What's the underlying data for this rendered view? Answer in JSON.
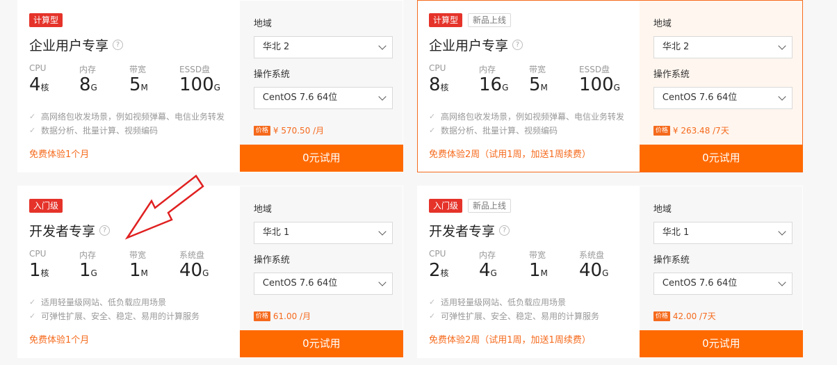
{
  "cards": [
    {
      "tags": [
        "计算型"
      ],
      "title": "企业用户专享",
      "specs": [
        {
          "label": "CPU",
          "value": "4",
          "unit": "核"
        },
        {
          "label": "内存",
          "value": "8",
          "unit": "G"
        },
        {
          "label": "带宽",
          "value": "5",
          "unit": "M"
        },
        {
          "label": "ESSD盘",
          "value": "100",
          "unit": "G"
        }
      ],
      "features": [
        "高网络包收发场景，例如视频弹幕、电信业务转发",
        "数据分析、批量计算、视频编码"
      ],
      "trial_note": "免费体验1个月",
      "region_label": "地域",
      "region": "华北 2",
      "os_label": "操作系统",
      "os": "CentOS 7.6 64位",
      "price_badge": "价格",
      "price": "¥ 570.50 /月",
      "button": "0元试用"
    },
    {
      "tags": [
        "计算型",
        "新品上线"
      ],
      "title": "企业用户专享",
      "specs": [
        {
          "label": "CPU",
          "value": "8",
          "unit": "核"
        },
        {
          "label": "内存",
          "value": "16",
          "unit": "G"
        },
        {
          "label": "带宽",
          "value": "5",
          "unit": "M"
        },
        {
          "label": "ESSD盘",
          "value": "100",
          "unit": "G"
        }
      ],
      "features": [
        "高网络包收发场景，例如视频弹幕、电信业务转发",
        "数据分析、批量计算、视频编码"
      ],
      "trial_note": "免费体验2周（试用1周，加送1周续费）",
      "region_label": "地域",
      "region": "华北 2",
      "os_label": "操作系统",
      "os": "CentOS 7.6 64位",
      "price_badge": "价格",
      "price": "¥ 263.48 /7天",
      "button": "0元试用"
    },
    {
      "tags": [
        "入门级"
      ],
      "title": "开发者专享",
      "specs": [
        {
          "label": "CPU",
          "value": "1",
          "unit": "核"
        },
        {
          "label": "内存",
          "value": "1",
          "unit": "G"
        },
        {
          "label": "带宽",
          "value": "1",
          "unit": "M"
        },
        {
          "label": "系统盘",
          "value": "40",
          "unit": "G"
        }
      ],
      "features": [
        "适用轻量级网站、低负载应用场景",
        "可弹性扩展、安全、稳定、易用的计算服务"
      ],
      "trial_note": "免费体验1个月",
      "region_label": "地域",
      "region": "华北 1",
      "os_label": "操作系统",
      "os": "CentOS 7.6 64位",
      "price_badge": "价格",
      "price": "61.00 /月",
      "button": "0元试用"
    },
    {
      "tags": [
        "入门级",
        "新品上线"
      ],
      "title": "开发者专享",
      "specs": [
        {
          "label": "CPU",
          "value": "2",
          "unit": "核"
        },
        {
          "label": "内存",
          "value": "4",
          "unit": "G"
        },
        {
          "label": "带宽",
          "value": "1",
          "unit": "M"
        },
        {
          "label": "系统盘",
          "value": "40",
          "unit": "G"
        }
      ],
      "features": [
        "适用轻量级网站、低负载应用场景",
        "可弹性扩展、安全、稳定、易用的计算服务"
      ],
      "trial_note": "免费体验2周（试用1周，加送1周续费）",
      "region_label": "地域",
      "region": "华北 1",
      "os_label": "操作系统",
      "os": "CentOS 7.6 64位",
      "price_badge": "价格",
      "price": "42.00 /7天",
      "button": "0元试用"
    }
  ],
  "colors": {
    "accent": "#ff6a00",
    "tag_red": "#e5332a",
    "arrow": "#e02020"
  }
}
